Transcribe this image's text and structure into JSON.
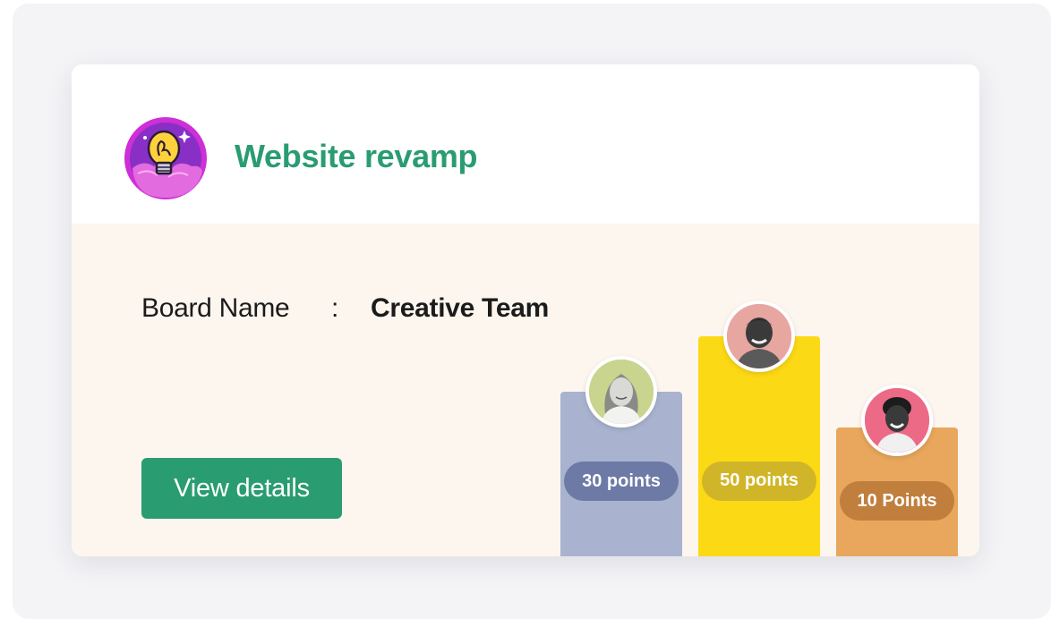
{
  "project": {
    "title": "Website revamp",
    "icon": "lightbulb-badge-icon"
  },
  "board": {
    "label": "Board Name",
    "separator": ":",
    "value": "Creative Team"
  },
  "actions": {
    "view_details_label": "View details"
  },
  "leaderboard": [
    {
      "points_label": "30 points",
      "points": 30,
      "bar_color": "#a9b3cf",
      "pill_color": "#6d7aa6",
      "avatar_bg": "#c9d48e"
    },
    {
      "points_label": "50 points",
      "points": 50,
      "bar_color": "#fcd915",
      "pill_color": "#d1b529",
      "avatar_bg": "#e8a6a1"
    },
    {
      "points_label": "10 Points",
      "points": 10,
      "bar_color": "#e8a75c",
      "pill_color": "#c17f3e",
      "avatar_bg": "#ec6a86"
    }
  ],
  "colors": {
    "accent": "#2a9c72",
    "body_bg": "#fdf6ef"
  }
}
